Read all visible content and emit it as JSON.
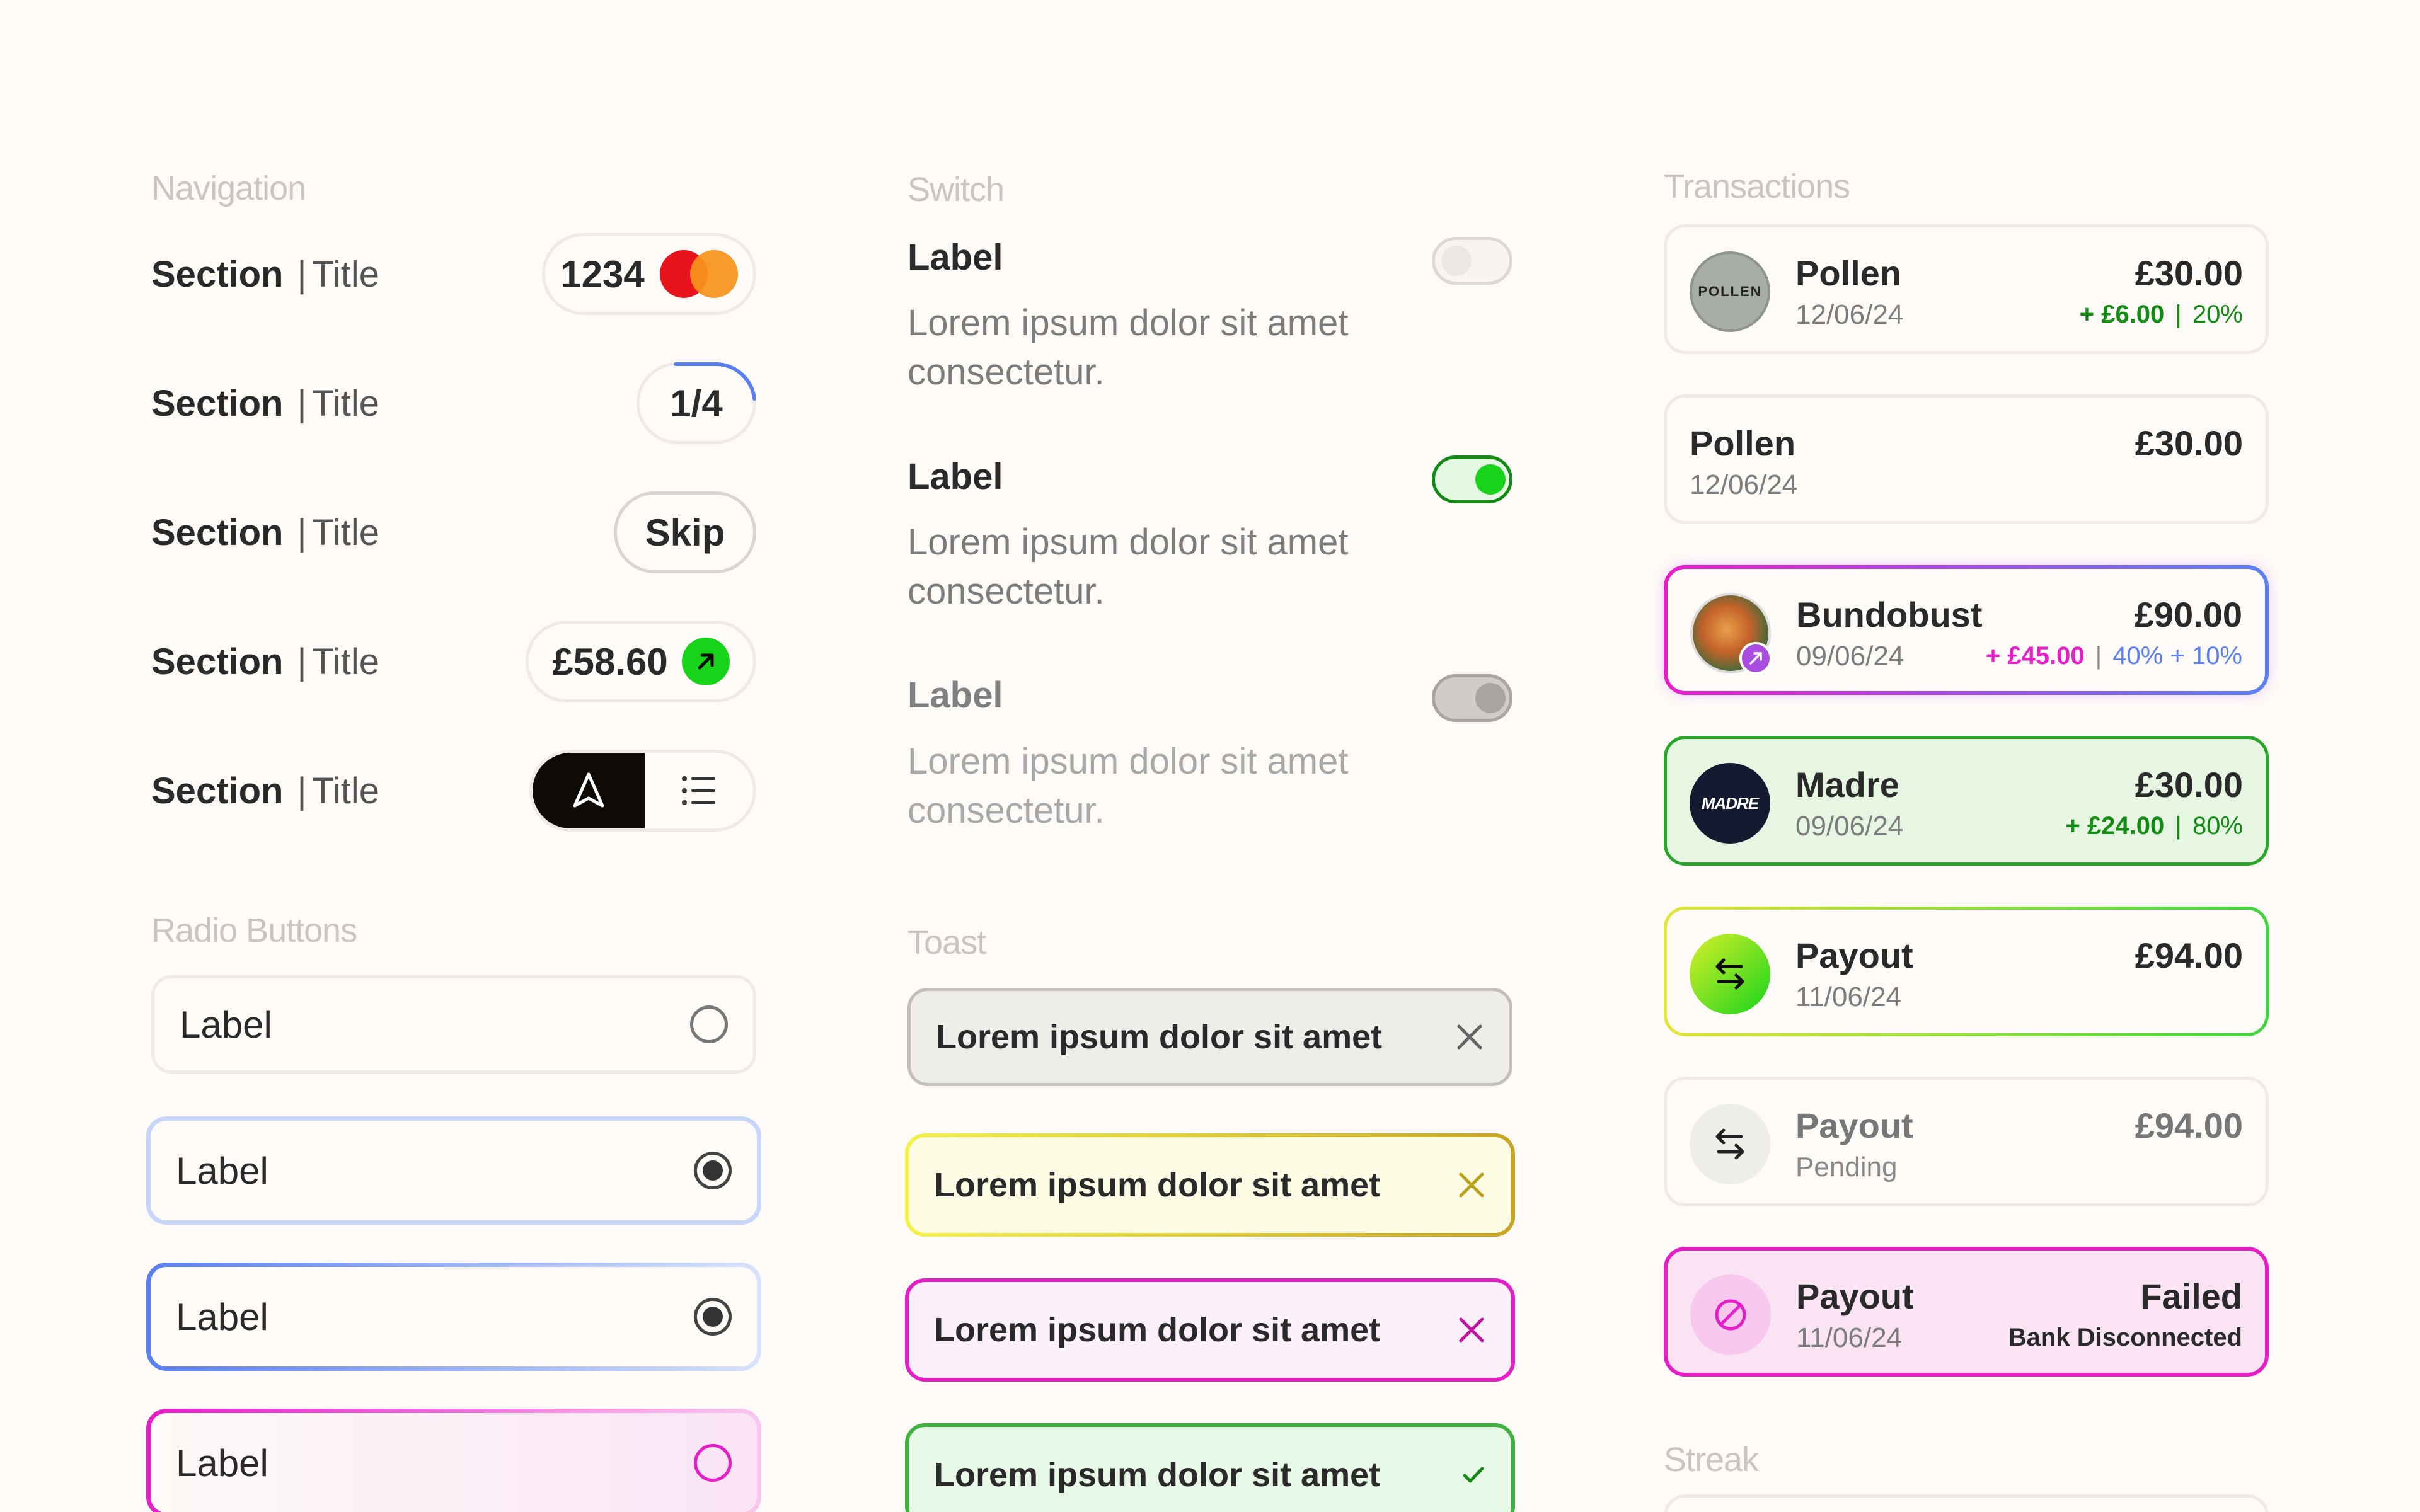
{
  "navigation": {
    "heading": "Navigation",
    "rows": [
      {
        "section": "Section",
        "sep": "|",
        "title": "Title",
        "pill": "1234"
      },
      {
        "section": "Section",
        "sep": "|",
        "title": "Title",
        "pill": "1/4"
      },
      {
        "section": "Section",
        "sep": "|",
        "title": "Title",
        "pill": "Skip"
      },
      {
        "section": "Section",
        "sep": "|",
        "title": "Title",
        "pill": "£58.60"
      },
      {
        "section": "Section",
        "sep": "|",
        "title": "Title"
      }
    ],
    "progress_fraction": 0.25,
    "icons": {
      "card": "mastercard-icon",
      "arrow": "arrow-up-right-icon",
      "nav": "navigation-arrow-icon",
      "list": "list-icon"
    }
  },
  "radio": {
    "heading": "Radio Buttons",
    "items": [
      {
        "label": "Label",
        "selected": false
      },
      {
        "label": "Label",
        "selected": true
      },
      {
        "label": "Label",
        "selected": true
      },
      {
        "label": "Label",
        "selected": false
      }
    ]
  },
  "switch": {
    "heading": "Switch",
    "items": [
      {
        "label": "Label",
        "desc": "Lorem ipsum dolor sit amet consectetur.",
        "state": "off"
      },
      {
        "label": "Label",
        "desc": "Lorem ipsum dolor sit amet consectetur.",
        "state": "on"
      },
      {
        "label": "Label",
        "desc": "Lorem ipsum dolor sit amet consectetur.",
        "state": "disabled"
      }
    ]
  },
  "toast": {
    "heading": "Toast",
    "items": [
      {
        "text": "Lorem ipsum dolor sit amet",
        "variant": "neutral",
        "icon": "close-icon"
      },
      {
        "text": "Lorem ipsum dolor sit amet",
        "variant": "warning",
        "icon": "close-icon"
      },
      {
        "text": "Lorem ipsum dolor sit amet",
        "variant": "error",
        "icon": "close-icon"
      },
      {
        "text": "Lorem ipsum dolor sit amet",
        "variant": "success",
        "icon": "check-icon"
      }
    ]
  },
  "transactions": {
    "heading": "Transactions",
    "items": [
      {
        "name": "Pollen",
        "date": "12/06/24",
        "amount": "£30.00",
        "cashback": "+ £6.00",
        "divider": "|",
        "percent": "20%",
        "logo_text": "POLLEN"
      },
      {
        "name": "Pollen",
        "date": "12/06/24",
        "amount": "£30.00"
      },
      {
        "name": "Bundobust",
        "date": "09/06/24",
        "amount": "£90.00",
        "cashback": "+ £45.00",
        "divider": "|",
        "percent": "40% + 10%"
      },
      {
        "name": "Madre",
        "date": "09/06/24",
        "amount": "£30.00",
        "cashback": "+ £24.00",
        "divider": "|",
        "percent": "80%",
        "logo_text": "MADRE"
      },
      {
        "name": "Payout",
        "date": "11/06/24",
        "amount": "£94.00"
      },
      {
        "name": "Payout",
        "date": "Pending",
        "amount": "£94.00"
      },
      {
        "name": "Payout",
        "date": "11/06/24",
        "amount": "Failed",
        "status_detail": "Bank Disconnected"
      }
    ]
  },
  "streak": {
    "heading": "Streak"
  },
  "colors": {
    "background": "#fdfaf7",
    "success_green": "#17d41a",
    "cashback_green": "#138a14",
    "magenta": "#e61ec8",
    "blue": "#5b7ff0",
    "yellow": "#e4e43a"
  }
}
